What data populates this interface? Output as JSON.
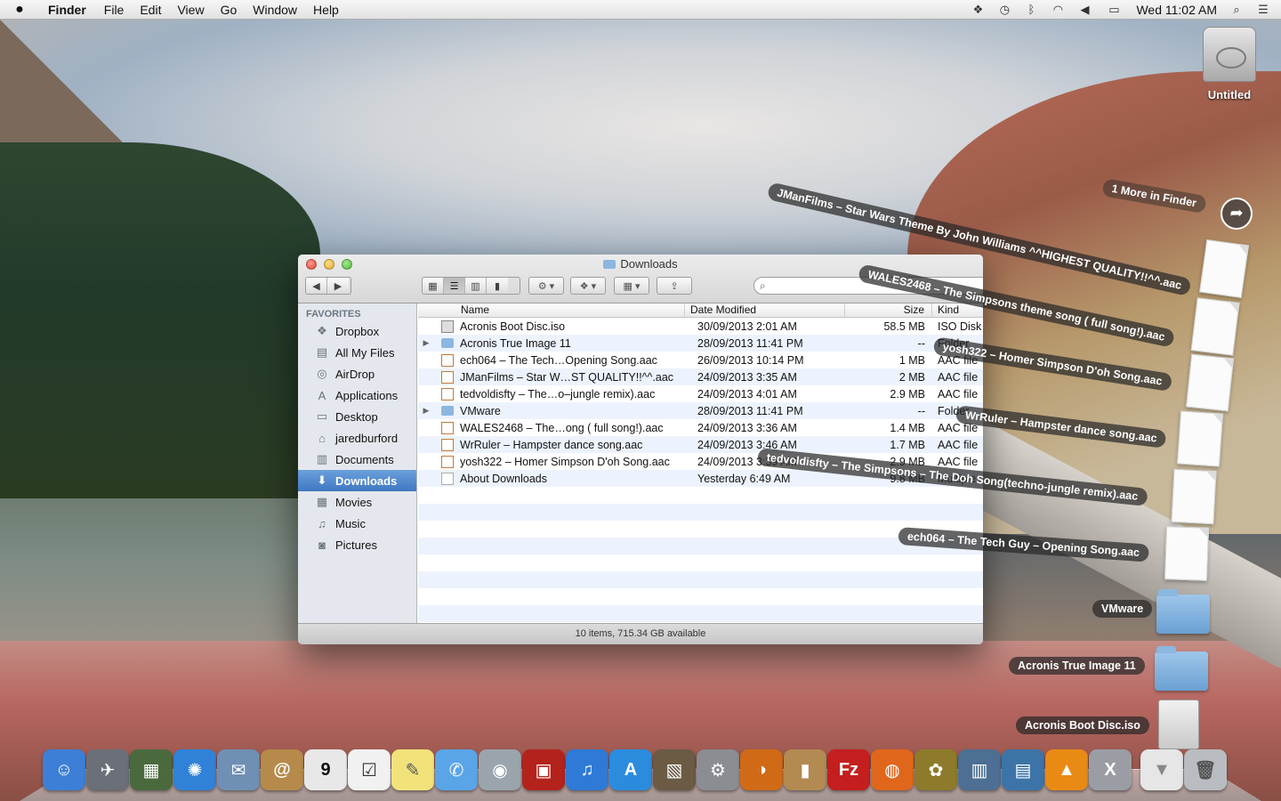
{
  "menubar": {
    "apple": "",
    "app_name": "Finder",
    "menus": [
      "File",
      "Edit",
      "View",
      "Go",
      "Window",
      "Help"
    ],
    "clock": "Wed 11:02 AM",
    "status_icons": [
      "dropbox-icon",
      "time-machine-icon",
      "bluetooth-icon",
      "wifi-icon",
      "volume-icon",
      "battery-icon",
      "spotlight-icon",
      "notification-center-icon"
    ]
  },
  "desktop": {
    "disk_label": "Untitled"
  },
  "stack": {
    "more_label": "1 More in Finder",
    "items": [
      {
        "label": "JManFilms – Star Wars Theme By John Williams ^^HIGHEST QUALITY!!^^.aac",
        "kind": "doc"
      },
      {
        "label": "WALES2468 – The Simpsons theme song ( full song!).aac",
        "kind": "doc"
      },
      {
        "label": "yosh322 – Homer Simpson D'oh Song.aac",
        "kind": "doc"
      },
      {
        "label": "WrRuler – Hampster dance song.aac",
        "kind": "doc"
      },
      {
        "label": "tedvoldisfty – The Simpsons – The Doh Song(techno-jungle remix).aac",
        "kind": "doc"
      },
      {
        "label": "ech064 – The Tech Guy – Opening Song.aac",
        "kind": "doc"
      },
      {
        "label": "VMware",
        "kind": "folder"
      },
      {
        "label": "Acronis True Image 11",
        "kind": "folder"
      },
      {
        "label": "Acronis Boot Disc.iso",
        "kind": "iso"
      }
    ]
  },
  "finder": {
    "title": "Downloads",
    "sidebar_heading": "FAVORITES",
    "sidebar": [
      {
        "label": "Dropbox",
        "icon": "dropbox-icon",
        "glyph": "❖"
      },
      {
        "label": "All My Files",
        "icon": "all-files-icon",
        "glyph": "▤"
      },
      {
        "label": "AirDrop",
        "icon": "airdrop-icon",
        "glyph": "◎"
      },
      {
        "label": "Applications",
        "icon": "applications-icon",
        "glyph": "A"
      },
      {
        "label": "Desktop",
        "icon": "desktop-icon",
        "glyph": "▭"
      },
      {
        "label": "jaredburford",
        "icon": "home-icon",
        "glyph": "⌂"
      },
      {
        "label": "Documents",
        "icon": "documents-icon",
        "glyph": "▥"
      },
      {
        "label": "Downloads",
        "icon": "downloads-icon",
        "glyph": "⬇",
        "selected": true
      },
      {
        "label": "Movies",
        "icon": "movies-icon",
        "glyph": "▦"
      },
      {
        "label": "Music",
        "icon": "music-icon",
        "glyph": "♫"
      },
      {
        "label": "Pictures",
        "icon": "pictures-icon",
        "glyph": "◙"
      }
    ],
    "columns": {
      "name": "Name",
      "date": "Date Modified",
      "size": "Size",
      "kind": "Kind"
    },
    "files": [
      {
        "name": "Acronis Boot Disc.iso",
        "date": "30/09/2013 2:01 AM",
        "size": "58.5 MB",
        "kind": "ISO Disk",
        "type": "iso",
        "folder": false
      },
      {
        "name": "Acronis True Image 11",
        "date": "28/09/2013 11:41 PM",
        "size": "--",
        "kind": "Folder",
        "type": "folder",
        "folder": true
      },
      {
        "name": "ech064 – The Tech…Opening Song.aac",
        "date": "26/09/2013 10:14 PM",
        "size": "1 MB",
        "kind": "AAC file",
        "type": "aac",
        "folder": false
      },
      {
        "name": "JManFilms – Star W…ST QUALITY!!^^.aac",
        "date": "24/09/2013 3:35 AM",
        "size": "2 MB",
        "kind": "AAC file",
        "type": "aac",
        "folder": false
      },
      {
        "name": "tedvoldisfty – The…o–jungle remix).aac",
        "date": "24/09/2013 4:01 AM",
        "size": "2.9 MB",
        "kind": "AAC file",
        "type": "aac",
        "folder": false
      },
      {
        "name": "VMware",
        "date": "28/09/2013 11:41 PM",
        "size": "--",
        "kind": "Folder",
        "type": "folder",
        "folder": true
      },
      {
        "name": "WALES2468 – The…ong ( full song!).aac",
        "date": "24/09/2013 3:36 AM",
        "size": "1.4 MB",
        "kind": "AAC file",
        "type": "aac",
        "folder": false
      },
      {
        "name": "WrRuler – Hampster dance song.aac",
        "date": "24/09/2013 3:46 AM",
        "size": "1.7 MB",
        "kind": "AAC file",
        "type": "aac",
        "folder": false
      },
      {
        "name": "yosh322 – Homer Simpson D'oh Song.aac",
        "date": "24/09/2013 3:39 AM",
        "size": "2.9 MB",
        "kind": "AAC file",
        "type": "aac",
        "folder": false
      },
      {
        "name": "About Downloads",
        "date": "Yesterday 6:49 AM",
        "size": "9.8 MB",
        "kind": "Multiple",
        "type": "doc",
        "folder": false
      }
    ],
    "status": "10 items, 715.34 GB available"
  },
  "dock": [
    {
      "name": "finder",
      "color": "#3d7fd6",
      "glyph": "☺"
    },
    {
      "name": "launchpad",
      "color": "#6b6f78",
      "glyph": "✈"
    },
    {
      "name": "mission-control",
      "color": "#4a6a3e",
      "glyph": "▦"
    },
    {
      "name": "safari",
      "color": "#2f82d8",
      "glyph": "✺"
    },
    {
      "name": "mail-eagle",
      "color": "#6f8fb5",
      "glyph": "✉"
    },
    {
      "name": "contacts",
      "color": "#b58a4a",
      "glyph": "@"
    },
    {
      "name": "calendar",
      "color": "#e8e8e8",
      "glyph": "9",
      "text": "#111"
    },
    {
      "name": "reminders",
      "color": "#f1f1f1",
      "glyph": "☑",
      "text": "#333"
    },
    {
      "name": "notes",
      "color": "#f2e27a",
      "glyph": "✎",
      "text": "#555"
    },
    {
      "name": "messages",
      "color": "#5aa5e8",
      "glyph": "✆"
    },
    {
      "name": "facetime",
      "color": "#9aa4ad",
      "glyph": "◉"
    },
    {
      "name": "photo-booth",
      "color": "#b3231c",
      "glyph": "▣"
    },
    {
      "name": "itunes",
      "color": "#2f7ad6",
      "glyph": "♫"
    },
    {
      "name": "app-store",
      "color": "#2b8cde",
      "glyph": "A"
    },
    {
      "name": "iphoto",
      "color": "#6b5b44",
      "glyph": "▧"
    },
    {
      "name": "system-preferences",
      "color": "#8a8d92",
      "glyph": "⚙"
    },
    {
      "name": "audacity",
      "color": "#d06a16",
      "glyph": "◑"
    },
    {
      "name": "compressor",
      "color": "#b38a52",
      "glyph": "▮"
    },
    {
      "name": "filezilla",
      "color": "#c41e1e",
      "glyph": "Fz"
    },
    {
      "name": "firefox",
      "color": "#e0661c",
      "glyph": "◍"
    },
    {
      "name": "pineapple",
      "color": "#8d7a2a",
      "glyph": "✿"
    },
    {
      "name": "activity-monitor",
      "color": "#4d6f93",
      "glyph": "▥"
    },
    {
      "name": "archive-utility",
      "color": "#3d74a8",
      "glyph": "▤"
    },
    {
      "name": "vlc",
      "color": "#e98a15",
      "glyph": "▲"
    },
    {
      "name": "x11",
      "color": "#9a9ea4",
      "glyph": "X"
    },
    {
      "name": "sep",
      "color": "",
      "glyph": ""
    },
    {
      "name": "downloads-stack",
      "color": "#e6e6e6",
      "glyph": "▼",
      "text": "#888"
    },
    {
      "name": "trash",
      "color": "#b9bcc0",
      "glyph": "🗑",
      "text": "#555"
    }
  ]
}
